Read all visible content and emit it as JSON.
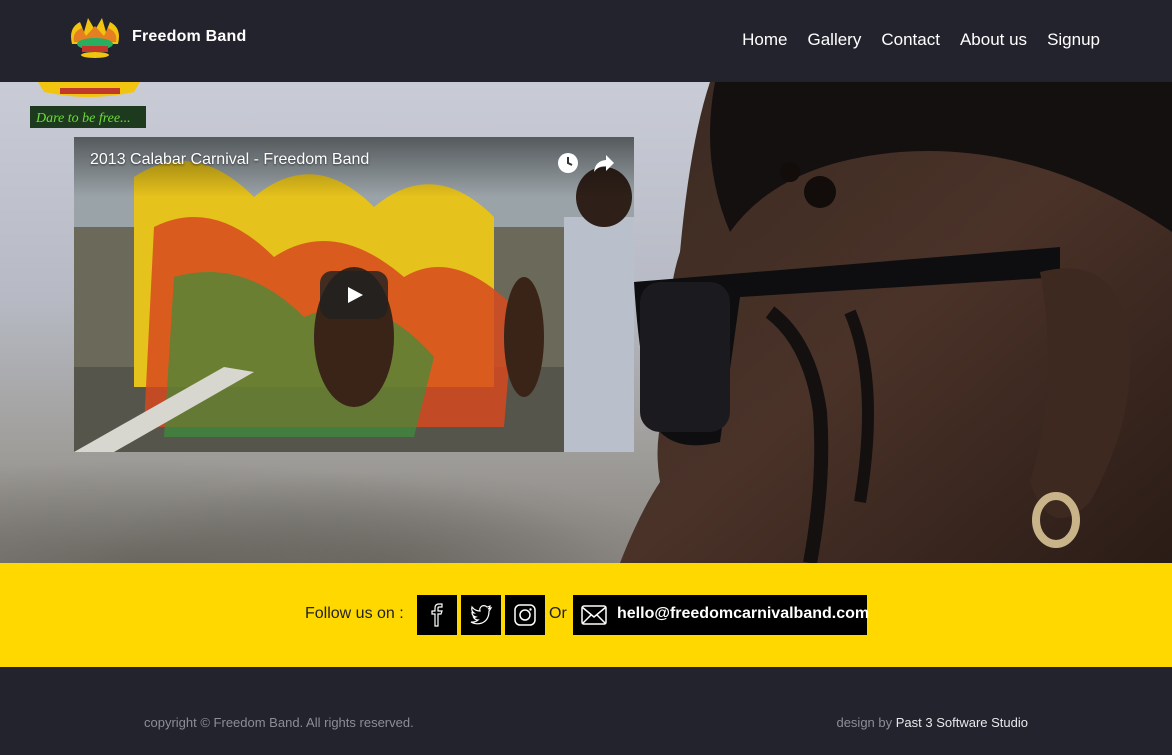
{
  "header": {
    "brand": "Freedom Band",
    "nav": [
      "Home",
      "Gallery",
      "Contact",
      "About us",
      "Signup"
    ]
  },
  "hero": {
    "badge_text": "Dare to be free...",
    "video_title": "2013 Calabar Carnival - Freedom Band"
  },
  "social": {
    "follow_label": "Follow us on :",
    "or_label": "Or",
    "email": "hello@freedomcarnivalband.com",
    "icons": [
      "facebook-icon",
      "twitter-icon",
      "instagram-icon",
      "mail-icon"
    ]
  },
  "footer": {
    "copyright": "copyright © Freedom Band. All rights reserved.",
    "design_prefix": "design by",
    "designer": "Past 3 Software Studio"
  },
  "colors": {
    "header_bg": "#23232e",
    "accent_yellow": "#ffd800",
    "icon_bg": "#000000"
  }
}
